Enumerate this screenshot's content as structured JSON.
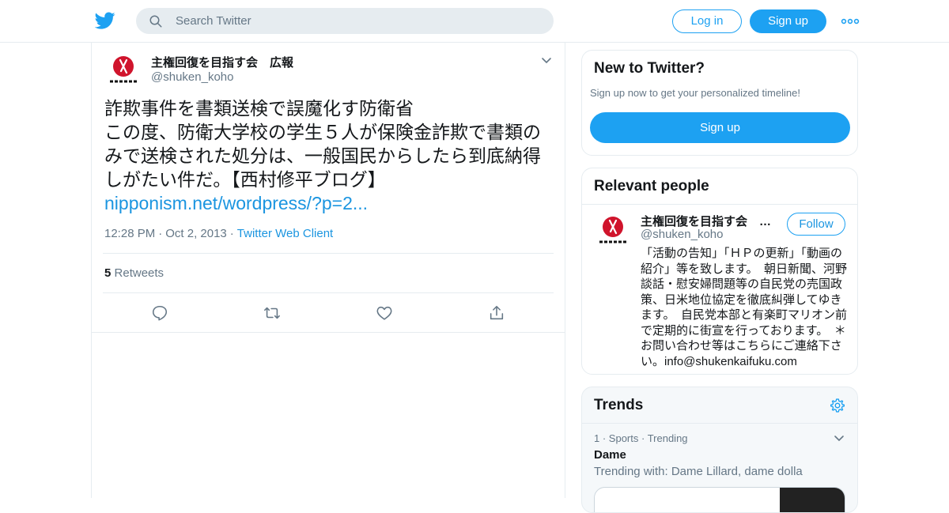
{
  "topbar": {
    "search_placeholder": "Search Twitter",
    "login_label": "Log in",
    "signup_label": "Sign up",
    "brand_color": "#1da1f2"
  },
  "tweet": {
    "author_name": "主権回復を目指す会　広報",
    "author_handle": "@shuken_koho",
    "text": "詐欺事件を書類送検で誤魔化す防衛省\nこの度、防衛大学校の学生５人が保険金詐欺で書類のみで送検された処分は、一般国民からしたら到底納得しがたい件だ。【西村修平ブログ】",
    "link_text": "nipponism.net/wordpress/?p=2...",
    "time": "12:28 PM",
    "date": "Oct 2, 2013",
    "client": "Twitter Web Client",
    "retweet_count": "5",
    "retweet_label": "Retweets"
  },
  "sidebar": {
    "new_to_twitter": {
      "title": "New to Twitter?",
      "subtitle": "Sign up now to get your personalized timeline!",
      "signup_label": "Sign up"
    },
    "relevant_people": {
      "title": "Relevant people",
      "name": "主権回復を目指す会　…",
      "handle": "@shuken_koho",
      "follow_label": "Follow",
      "bio": "「活動の告知」「ＨＰの更新」「動画の紹介」等を致します。　朝日新聞、河野談話・慰安婦問題等の自民党の売国政策、日米地位協定を徹底糾弾してゆきます。　自民党本部と有楽町マリオン前で定期的に街宣を行っております。　＊お問い合わせ等はこちらにご連絡下さい。info@shukenkaifuku.com"
    },
    "trends": {
      "title": "Trends",
      "rank": "1",
      "category": "Sports",
      "status": "Trending",
      "name": "Dame",
      "with_text": "Trending with: Dame Lillard, dame dolla"
    }
  }
}
